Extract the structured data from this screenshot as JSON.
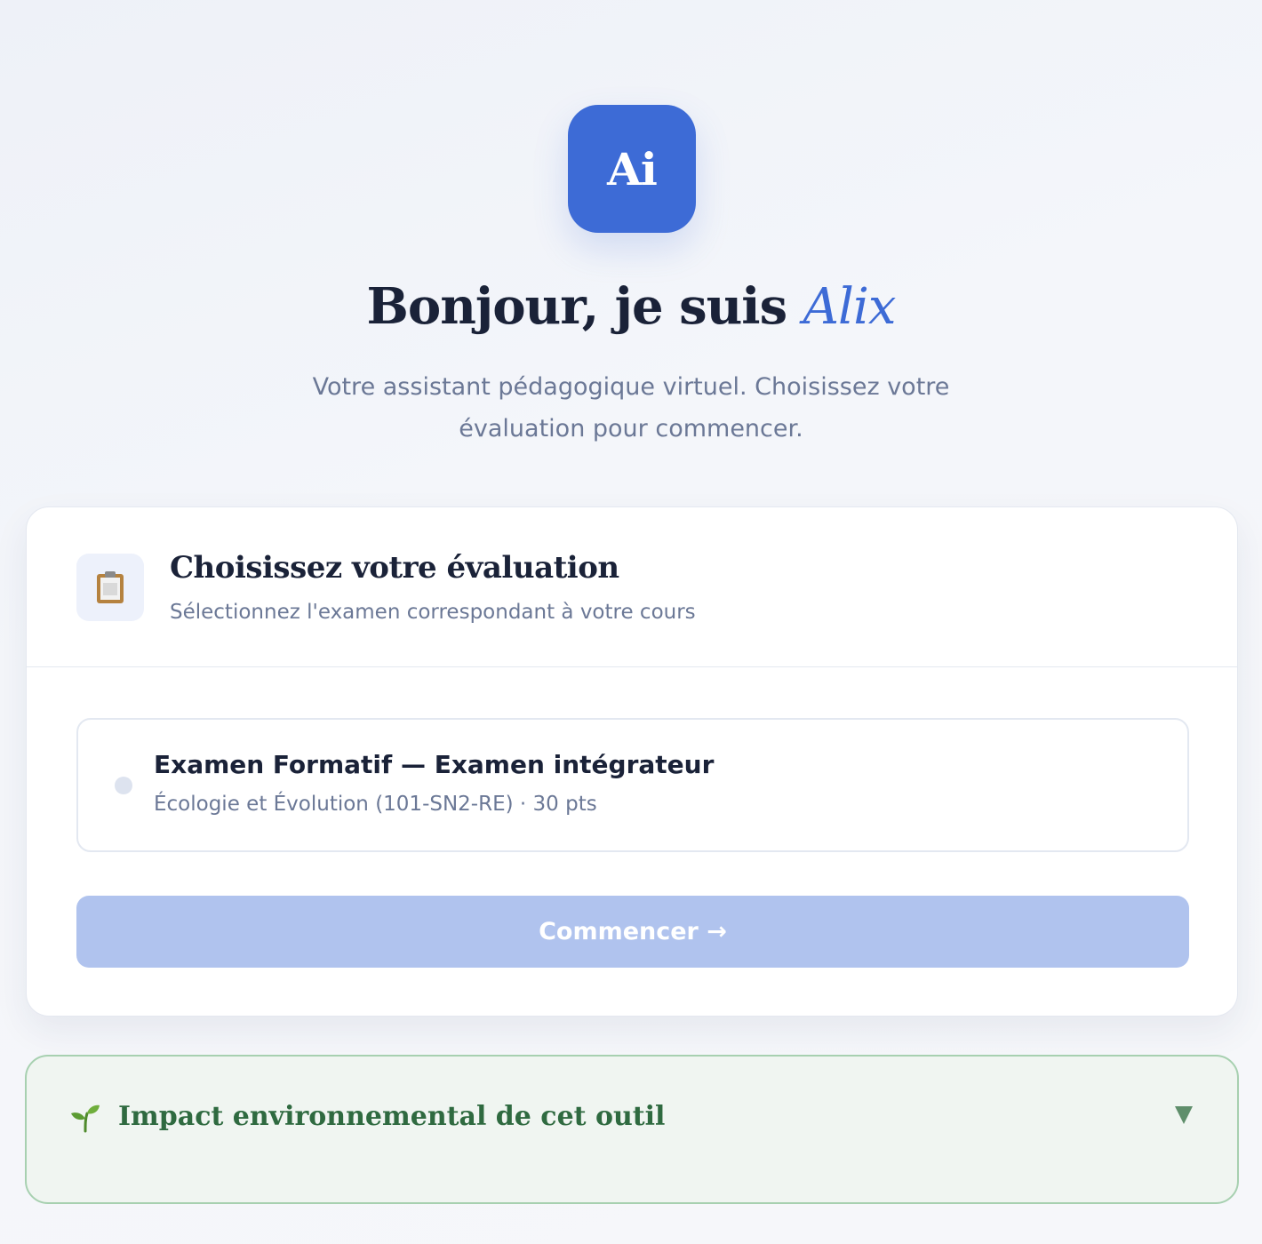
{
  "header": {
    "logo_text": "Ai",
    "title_prefix": "Bonjour, je suis ",
    "assistant_name": "Alix",
    "subtitle": "Votre assistant pédagogique virtuel. Choisissez votre évaluation pour commencer."
  },
  "selection_card": {
    "icon": "clipboard-icon",
    "title": "Choisissez votre évaluation",
    "subtitle": "Sélectionnez l'examen correspondant à votre cours",
    "options": [
      {
        "title": "Examen Formatif — Examen intégrateur",
        "details": "Écologie et Évolution (101-SN2-RE) · 30 pts",
        "selected": false
      }
    ],
    "start_button": "Commencer →",
    "start_button_enabled": false
  },
  "environment_panel": {
    "icon": "seedling-icon",
    "title": "Impact environnemental de cet outil",
    "expanded": false,
    "toggle_icon": "caret-down-icon"
  },
  "colors": {
    "accent": "#3d6bd6",
    "button_disabled": "#b0c3ee",
    "env_border": "#a7d0b0",
    "env_text": "#2f6a40"
  }
}
